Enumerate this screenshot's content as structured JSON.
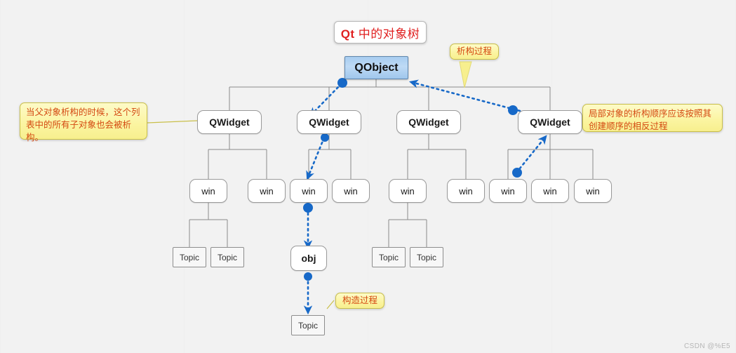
{
  "diagram": {
    "title": "Qt 中的对象树",
    "title_prefix": "Qt",
    "title_rest": " 中的对象树"
  },
  "callouts": {
    "left": "当父对象析构的时候，这个列表中的所有子对象也会被析构。",
    "right": "局部对象的析构顺序应该按照其创建顺序的相反过程",
    "destruct": "析构过程",
    "construct": "构造过程"
  },
  "nodes": {
    "root": {
      "label": "QObject"
    },
    "qwidgets": [
      {
        "label": "QWidget"
      },
      {
        "label": "QWidget"
      },
      {
        "label": "QWidget"
      },
      {
        "label": "QWidget"
      }
    ],
    "wins": [
      {
        "label": "win"
      },
      {
        "label": "win"
      },
      {
        "label": "win"
      },
      {
        "label": "win"
      },
      {
        "label": "win"
      },
      {
        "label": "win"
      },
      {
        "label": "win"
      },
      {
        "label": "win"
      },
      {
        "label": "win"
      }
    ],
    "topics": [
      {
        "label": "Topic"
      },
      {
        "label": "Topic"
      },
      {
        "label": "Topic"
      },
      {
        "label": "Topic"
      },
      {
        "label": "Topic"
      }
    ],
    "obj": {
      "label": "obj"
    }
  },
  "colors": {
    "title_text": "#e02020",
    "root_fill": "#b3d4f2",
    "callout_fill": "#fbf4a0",
    "callout_text": "#d44a12",
    "arrow": "#1769c8",
    "tree_line": "#8a8a8a"
  },
  "watermark": "CSDN @%E5"
}
